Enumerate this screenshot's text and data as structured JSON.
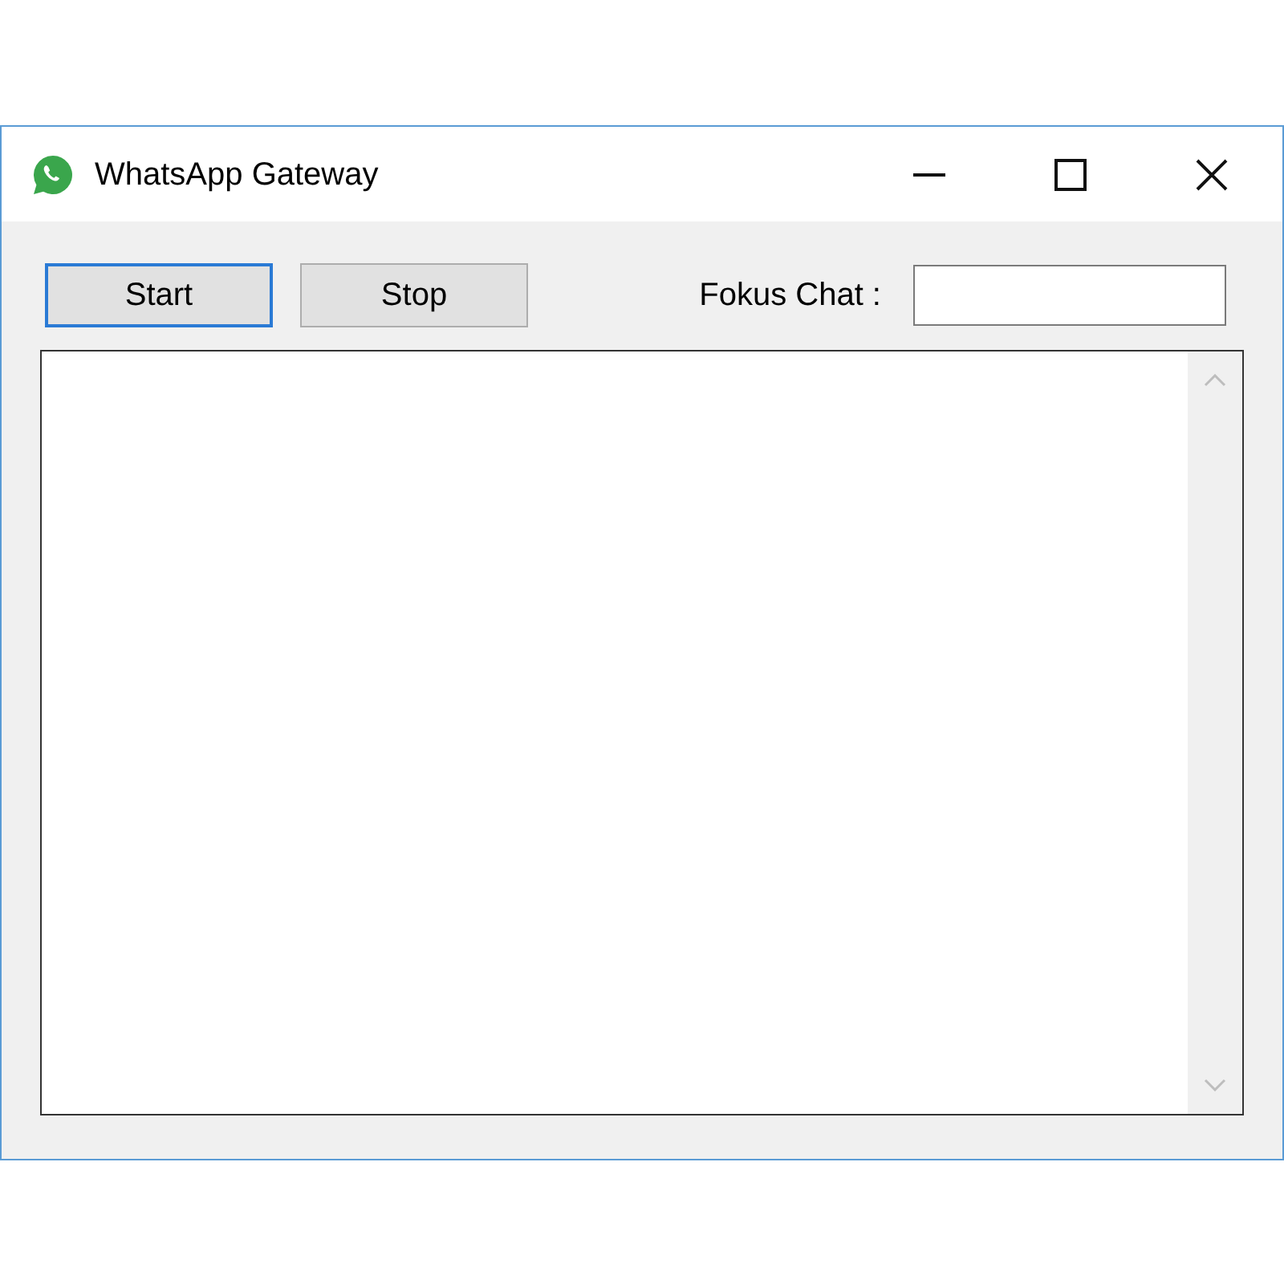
{
  "window": {
    "title": "WhatsApp Gateway"
  },
  "buttons": [
    {
      "label": "Start",
      "focused": true
    },
    {
      "label": "Stop",
      "focused": false
    }
  ],
  "fokus_chat": {
    "label": "Fokus Chat :"
  }
}
